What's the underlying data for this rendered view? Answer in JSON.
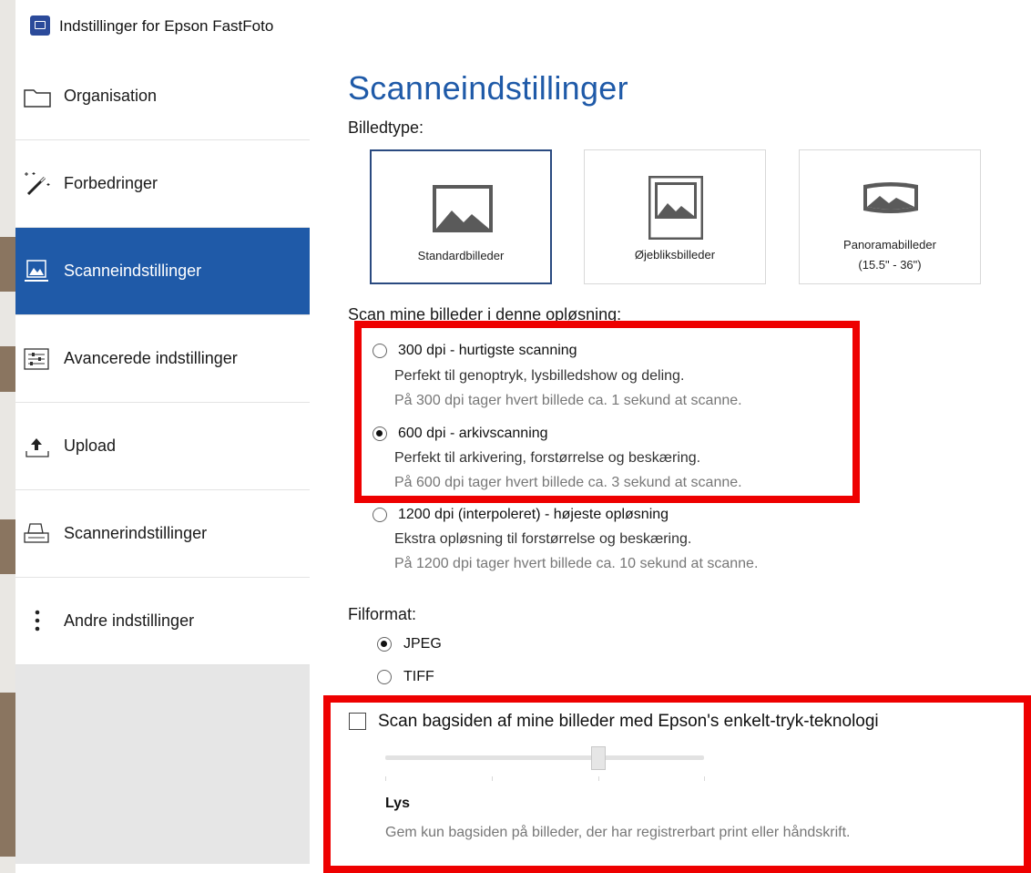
{
  "window": {
    "title": "Indstillinger for Epson FastFoto"
  },
  "sidebar": {
    "items": [
      {
        "label": "Organisation",
        "icon": "folder-icon"
      },
      {
        "label": "Forbedringer",
        "icon": "magic-wand-icon"
      },
      {
        "label": "Scanneindstillinger",
        "icon": "scan-photo-icon",
        "active": true
      },
      {
        "label": "Avancerede indstillinger",
        "icon": "sliders-icon"
      },
      {
        "label": "Upload",
        "icon": "upload-icon"
      },
      {
        "label": "Scannerindstillinger",
        "icon": "scanner-icon"
      },
      {
        "label": "Andre indstillinger",
        "icon": "more-vertical-icon"
      }
    ]
  },
  "main": {
    "title": "Scanneindstillinger",
    "image_type": {
      "label": "Billedtype:",
      "options": [
        {
          "label": "Standardbilleder",
          "selected": true
        },
        {
          "label": "Øjebliksbilleder",
          "selected": false
        },
        {
          "label": "Panoramabilleder",
          "sub": "(15.5\" - 36\")",
          "selected": false
        }
      ]
    },
    "resolution": {
      "label": "Scan mine billeder i denne opløsning:",
      "options": [
        {
          "title": "300 dpi - hurtigste scanning",
          "desc": "Perfekt til genoptryk, lysbilledshow og deling.",
          "note": "På 300 dpi tager hvert billede ca. 1 sekund at scanne.",
          "checked": false
        },
        {
          "title": "600 dpi - arkivscanning",
          "desc": "Perfekt til arkivering, forstørrelse og beskæring.",
          "note": "På 600 dpi tager hvert billede ca. 3 sekund at scanne.",
          "checked": true
        },
        {
          "title": "1200 dpi (interpoleret) - højeste opløsning",
          "desc": "Ekstra opløsning til forstørrelse og beskæring.",
          "note": "På 1200 dpi tager hvert billede ca. 10 sekund at scanne.",
          "checked": false
        }
      ]
    },
    "file_format": {
      "label": "Filformat:",
      "options": [
        {
          "label": "JPEG",
          "checked": true
        },
        {
          "label": "TIFF",
          "checked": false
        }
      ]
    },
    "backside": {
      "checkbox_label": "Scan bagsiden af mine billeder med Epson's enkelt-tryk-teknologi",
      "checked": false,
      "slider_value_label": "Lys",
      "description": "Gem kun bagsiden på billeder, der har registrerbart print eller håndskrift."
    }
  },
  "colors": {
    "accent": "#1f5aa8",
    "highlight": "#ee0000"
  }
}
